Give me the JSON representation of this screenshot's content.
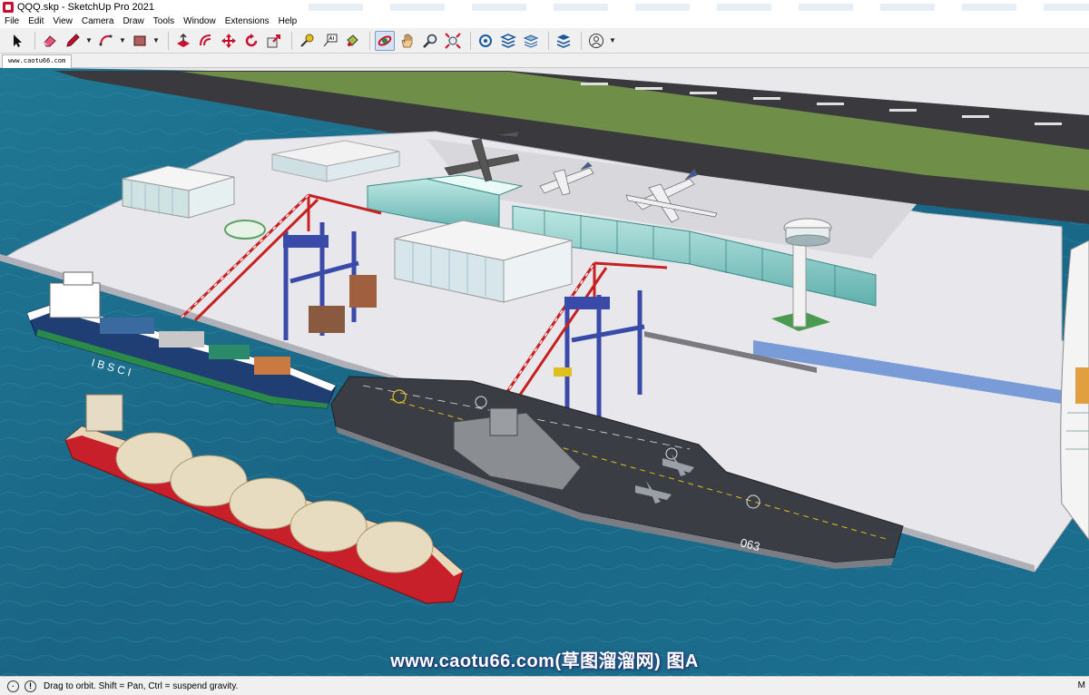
{
  "window": {
    "title": "QQQ.skp - SketchUp Pro 2021"
  },
  "menu": [
    "File",
    "Edit",
    "View",
    "Camera",
    "Draw",
    "Tools",
    "Window",
    "Extensions",
    "Help"
  ],
  "toolbar": {
    "tools": [
      {
        "name": "select-tool",
        "icon": "arrow-icon"
      },
      {
        "name": "eraser-tool",
        "icon": "eraser-icon"
      },
      {
        "name": "line-tool",
        "icon": "pencil-icon"
      },
      {
        "name": "arc-tool",
        "icon": "arc-icon"
      },
      {
        "name": "shape-tool",
        "icon": "rectangle-icon"
      },
      {
        "name": "push-pull-tool",
        "icon": "push-pull-icon"
      },
      {
        "name": "offset-tool",
        "icon": "offset-icon"
      },
      {
        "name": "move-tool",
        "icon": "move-icon"
      },
      {
        "name": "rotate-tool",
        "icon": "rotate-icon"
      },
      {
        "name": "scale-tool",
        "icon": "scale-icon"
      },
      {
        "name": "tape-measure-tool",
        "icon": "tape-icon"
      },
      {
        "name": "text-tool",
        "icon": "text-icon"
      },
      {
        "name": "paint-bucket-tool",
        "icon": "paint-icon"
      },
      {
        "name": "orbit-tool",
        "icon": "orbit-icon",
        "active": true
      },
      {
        "name": "pan-tool",
        "icon": "hand-icon"
      },
      {
        "name": "zoom-tool",
        "icon": "zoom-icon"
      },
      {
        "name": "zoom-extents-tool",
        "icon": "zoom-extents-icon"
      },
      {
        "name": "3d-warehouse-button",
        "icon": "warehouse-icon"
      },
      {
        "name": "extension-warehouse-button",
        "icon": "extension-icon"
      },
      {
        "name": "layout-button",
        "icon": "layers-icon"
      },
      {
        "name": "extension-manager-button",
        "icon": "manager-icon"
      },
      {
        "name": "account-button",
        "icon": "user-icon"
      }
    ]
  },
  "scene": {
    "tab_label": "www.caotu66.com"
  },
  "viewport": {
    "watermark": "www.caotu66.com(草图溜溜网) 图A",
    "ship_label_bsc": "I  B S C  I",
    "carrier_number": "063",
    "colors": {
      "sea": "#1f6e8a",
      "ground": "#e8e8ec",
      "grass": "#6f8f48",
      "runway": "#3a3a3e"
    }
  },
  "status": {
    "text": "Drag to orbit. Shift = Pan, Ctrl = suspend gravity.",
    "right_label": "M"
  }
}
